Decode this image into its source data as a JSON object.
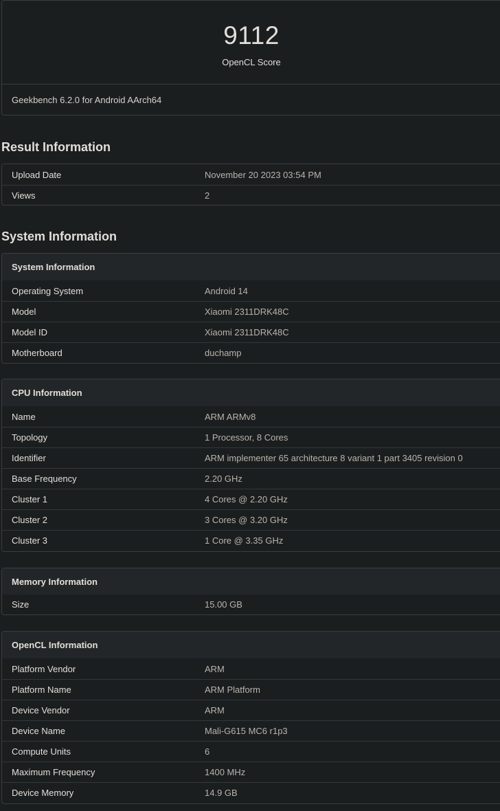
{
  "score": {
    "value": "9112",
    "label": "OpenCL Score",
    "version": "Geekbench 6.2.0 for Android AArch64"
  },
  "result_information": {
    "title": "Result Information",
    "rows": [
      {
        "key": "Upload Date",
        "value": "November 20 2023 03:54 PM"
      },
      {
        "key": "Views",
        "value": "2"
      }
    ]
  },
  "system_information": {
    "title": "System Information",
    "system": {
      "header": "System Information",
      "rows": [
        {
          "key": "Operating System",
          "value": "Android 14"
        },
        {
          "key": "Model",
          "value": "Xiaomi 2311DRK48C"
        },
        {
          "key": "Model ID",
          "value": "Xiaomi 2311DRK48C"
        },
        {
          "key": "Motherboard",
          "value": "duchamp"
        }
      ]
    },
    "cpu": {
      "header": "CPU Information",
      "rows": [
        {
          "key": "Name",
          "value": "ARM ARMv8"
        },
        {
          "key": "Topology",
          "value": "1 Processor, 8 Cores"
        },
        {
          "key": "Identifier",
          "value": "ARM implementer 65 architecture 8 variant 1 part 3405 revision 0"
        },
        {
          "key": "Base Frequency",
          "value": "2.20 GHz"
        },
        {
          "key": "Cluster 1",
          "value": "4 Cores @ 2.20 GHz"
        },
        {
          "key": "Cluster 2",
          "value": "3 Cores @ 3.20 GHz"
        },
        {
          "key": "Cluster 3",
          "value": "1 Core @ 3.35 GHz"
        }
      ]
    },
    "memory": {
      "header": "Memory Information",
      "rows": [
        {
          "key": "Size",
          "value": "15.00 GB"
        }
      ]
    },
    "opencl": {
      "header": "OpenCL Information",
      "rows": [
        {
          "key": "Platform Vendor",
          "value": "ARM"
        },
        {
          "key": "Platform Name",
          "value": "ARM Platform"
        },
        {
          "key": "Device Vendor",
          "value": "ARM"
        },
        {
          "key": "Device Name",
          "value": "Mali-G615 MC6 r1p3"
        },
        {
          "key": "Compute Units",
          "value": "6"
        },
        {
          "key": "Maximum Frequency",
          "value": "1400 MHz"
        },
        {
          "key": "Device Memory",
          "value": "14.9 GB"
        }
      ]
    }
  }
}
